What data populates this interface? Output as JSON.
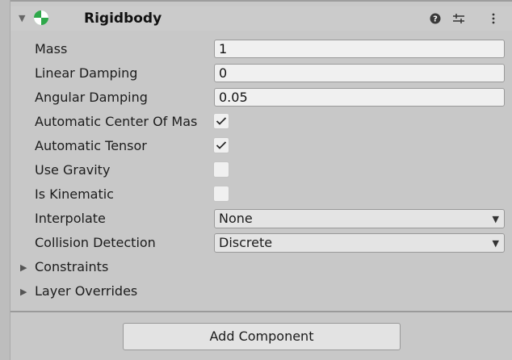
{
  "component": {
    "title": "Rigidbody",
    "fold_arrow": "▼",
    "icons": [
      "rigidbody-icon",
      "help-icon",
      "preset-icon",
      "kebab-menu-icon"
    ]
  },
  "fields": {
    "mass": {
      "label": "Mass",
      "value": "1"
    },
    "linear_damping": {
      "label": "Linear Damping",
      "value": "0"
    },
    "angular_damping": {
      "label": "Angular Damping",
      "value": "0.05"
    },
    "auto_center": {
      "label": "Automatic Center Of Mas",
      "checked": true
    },
    "auto_tensor": {
      "label": "Automatic Tensor",
      "checked": true
    },
    "use_gravity": {
      "label": "Use Gravity",
      "checked": false
    },
    "is_kinematic": {
      "label": "Is Kinematic",
      "checked": false
    },
    "interpolate": {
      "label": "Interpolate",
      "value": "None"
    },
    "collision": {
      "label": "Collision Detection",
      "value": "Discrete"
    }
  },
  "foldouts": {
    "constraints": "Constraints",
    "layer_overrides": "Layer Overrides"
  },
  "footer": {
    "add_component": "Add Component"
  },
  "colors": {
    "rigidbody_icon_green": "#2ea84a",
    "panel_bg": "#c8c8c8",
    "field_bg": "#f0f0f0"
  }
}
